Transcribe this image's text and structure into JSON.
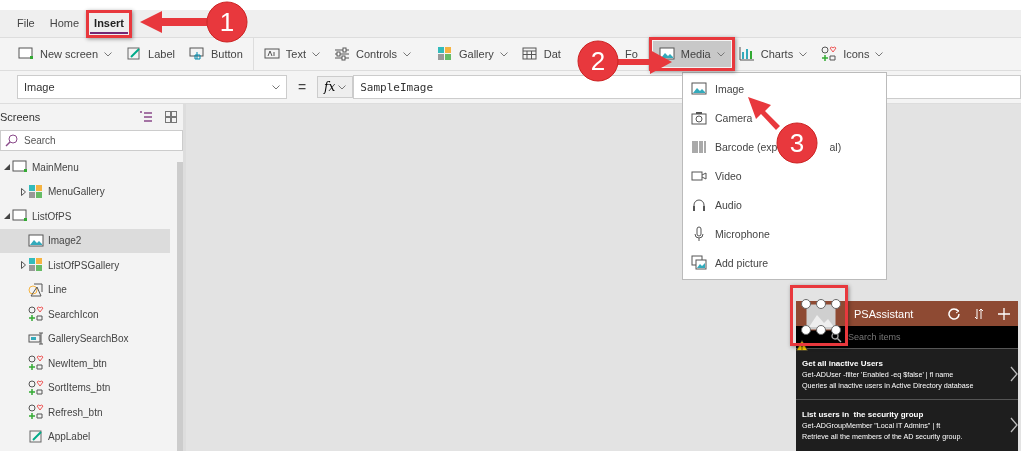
{
  "menu_tabs": [
    {
      "label": "File",
      "selected": false
    },
    {
      "label": "Home",
      "selected": false
    },
    {
      "label": "Insert",
      "selected": true
    }
  ],
  "ribbon": [
    {
      "label": "New screen",
      "kind": "screen",
      "dropdown": true,
      "selected": false
    },
    {
      "label": "Label",
      "kind": "label",
      "dropdown": false,
      "selected": false
    },
    {
      "label": "Button",
      "kind": "button",
      "dropdown": false,
      "selected": false
    },
    {
      "label": "Text",
      "kind": "text",
      "dropdown": true,
      "selected": false
    },
    {
      "label": "Controls",
      "kind": "controls",
      "dropdown": true,
      "selected": false
    },
    {
      "label": "Gallery",
      "kind": "gallery",
      "dropdown": true,
      "selected": false
    },
    {
      "label": "Dat",
      "kind": "table",
      "dropdown": false,
      "selected": false
    },
    {
      "label": "Fo",
      "kind": "none",
      "dropdown": false,
      "selected": false
    },
    {
      "label": "Media",
      "kind": "image",
      "dropdown": true,
      "selected": true
    },
    {
      "label": "Charts",
      "kind": "chart",
      "dropdown": true,
      "selected": false
    },
    {
      "label": "Icons",
      "kind": "icons",
      "dropdown": true,
      "selected": false
    }
  ],
  "formula_bar": {
    "property": "Image",
    "equals": "=",
    "fx": "fx",
    "formula": "SampleImage"
  },
  "tree_panel": {
    "title": "Screens",
    "search_placeholder": "Search",
    "items": [
      {
        "label": "MainMenu",
        "kind": "screen",
        "selected": false,
        "expanded": true,
        "children": [
          {
            "label": "MenuGallery",
            "kind": "gallery",
            "selected": false,
            "expanded": false
          }
        ]
      },
      {
        "label": "ListOfPS",
        "kind": "screen",
        "selected": false,
        "expanded": true,
        "children": [
          {
            "label": "Image2",
            "kind": "image",
            "selected": true
          },
          {
            "label": "ListOfPSGallery",
            "kind": "gallery",
            "selected": false,
            "expanded": false
          },
          {
            "label": "Line",
            "kind": "shape",
            "selected": false
          },
          {
            "label": "SearchIcon",
            "kind": "icon",
            "selected": false
          },
          {
            "label": "GallerySearchBox",
            "kind": "input",
            "selected": false
          },
          {
            "label": "NewItem_btn",
            "kind": "icon",
            "selected": false
          },
          {
            "label": "SortItems_btn",
            "kind": "icon",
            "selected": false
          },
          {
            "label": "Refresh_btn",
            "kind": "icon",
            "selected": false
          },
          {
            "label": "AppLabel",
            "kind": "label",
            "selected": false
          }
        ]
      }
    ]
  },
  "media_menu": [
    {
      "label": "Image",
      "kind": "image"
    },
    {
      "label": "Camera",
      "kind": "camera"
    },
    {
      "label": "Barcode (exp",
      "label_end": "al)",
      "kind": "barcode"
    },
    {
      "label": "Video",
      "kind": "video"
    },
    {
      "label": "Audio",
      "kind": "audio"
    },
    {
      "label": "Microphone",
      "kind": "microphone"
    },
    {
      "label": "Add picture",
      "kind": "addpicture"
    }
  ],
  "app_preview": {
    "title": "PSAssistant",
    "search_placeholder": "Search items",
    "rows": [
      {
        "title": "Get all inactive Users",
        "command": "Get-ADUser -filter 'Enabled -eq $false' | fl name",
        "description": "Queries all inactive users in Active Directory database"
      },
      {
        "title": "List users in  the security group",
        "command": "Get-ADGroupMember \"Local IT Admins\" | ft",
        "description": "Retrieve all the members of the AD security group."
      }
    ]
  },
  "callouts": [
    {
      "label": "1"
    },
    {
      "label": "2"
    },
    {
      "label": "3"
    }
  ]
}
